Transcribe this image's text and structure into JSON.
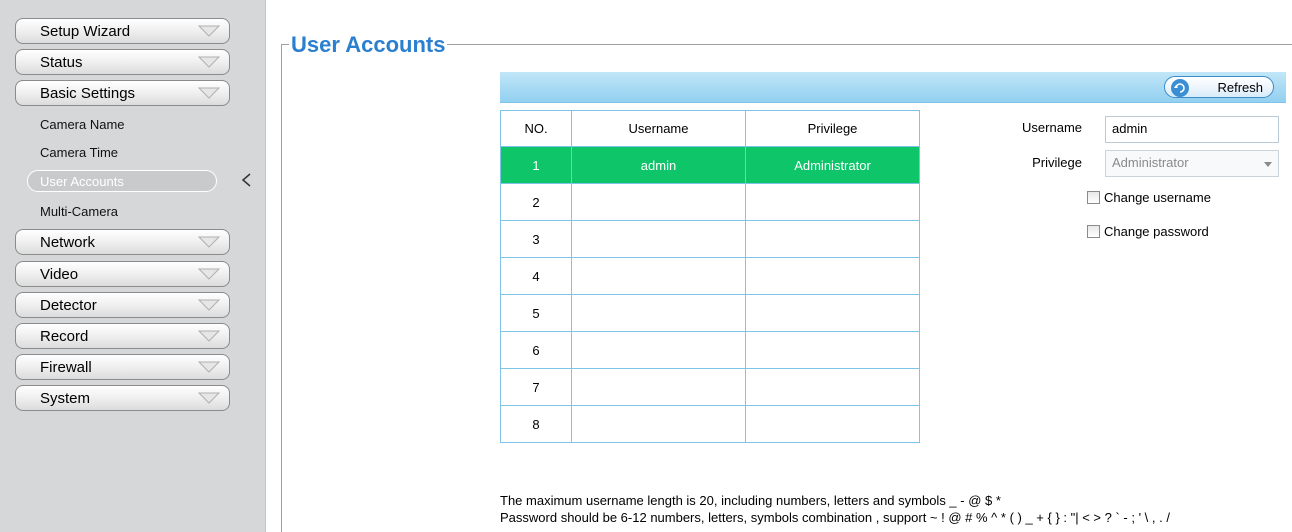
{
  "sidebar": {
    "top_items": [
      {
        "label": "Setup Wizard"
      },
      {
        "label": "Status"
      },
      {
        "label": "Basic Settings"
      }
    ],
    "sub_items": [
      {
        "label": "Camera Name"
      },
      {
        "label": "Camera Time"
      },
      {
        "label": "User Accounts"
      },
      {
        "label": "Multi-Camera"
      }
    ],
    "bottom_items": [
      {
        "label": "Network"
      },
      {
        "label": "Video"
      },
      {
        "label": "Detector"
      },
      {
        "label": "Record"
      },
      {
        "label": "Firewall"
      },
      {
        "label": "System"
      }
    ]
  },
  "main": {
    "title": "User Accounts",
    "refresh_label": "Refresh",
    "table": {
      "headers": [
        "NO.",
        "Username",
        "Privilege"
      ],
      "rows": [
        [
          "1",
          "admin",
          "Administrator"
        ],
        [
          "2",
          "",
          ""
        ],
        [
          "3",
          "",
          ""
        ],
        [
          "4",
          "",
          ""
        ],
        [
          "5",
          "",
          ""
        ],
        [
          "6",
          "",
          ""
        ],
        [
          "7",
          "",
          ""
        ],
        [
          "8",
          "",
          ""
        ]
      ]
    },
    "form": {
      "username_label": "Username",
      "username_value": "admin",
      "privilege_label": "Privilege",
      "privilege_value": "Administrator",
      "change_username_label": "Change username",
      "change_password_label": "Change password"
    },
    "notes": {
      "line1": "The maximum username length is 20, including numbers, letters and symbols _ - @ $ *",
      "line2": "Password should be 6-12 numbers, letters, symbols combination , support ~ ! @ # % ^ * ( ) _ + { } : \"| < > ? ` - ; ' \\ , . /"
    }
  },
  "colors": {
    "selected_row": "#0ec56a",
    "title": "#2a7fd0",
    "toolbar": "#a9dbf4"
  }
}
